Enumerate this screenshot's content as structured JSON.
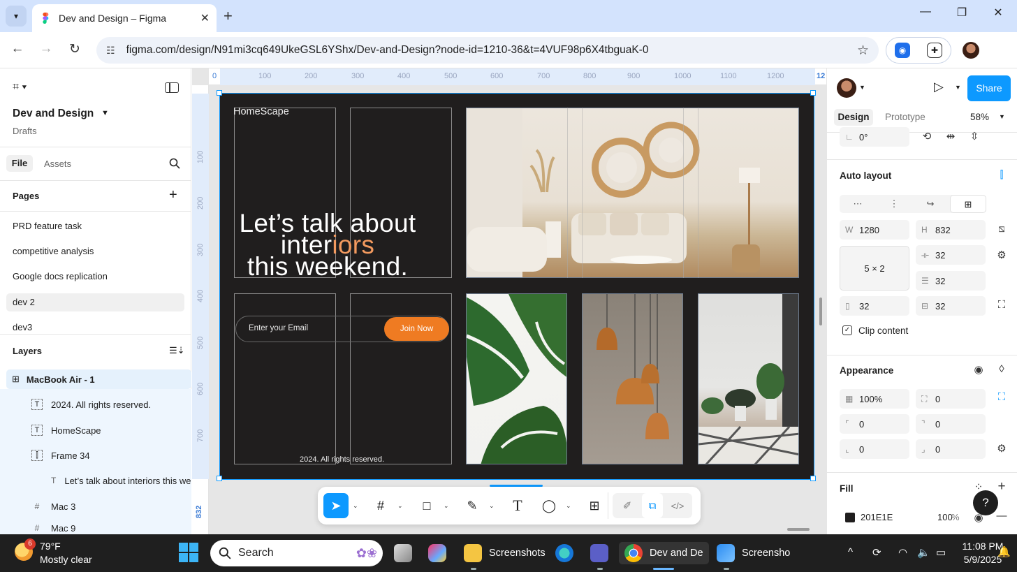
{
  "browser": {
    "tab_title": "Dev and Design – Figma",
    "url": "figma.com/design/N91mi3cq649UkeGSL6YShx/Dev-and-Design?node-id=1210-36&t=4VUF98p6X4tbguaK-0",
    "new_tab": "+",
    "tab_close": "✕"
  },
  "left": {
    "project_name": "Dev and Design",
    "project_location": "Drafts",
    "tab_file": "File",
    "tab_assets": "Assets",
    "pages_title": "Pages",
    "pages": [
      "PRD feature task",
      "competitive analysis",
      "Google docs replication",
      "dev 2",
      "dev3"
    ],
    "active_page": "dev 2",
    "layers_title": "Layers",
    "layers": [
      {
        "label": "MacBook Air - 1",
        "icon": "frame-grid-icon"
      },
      {
        "label": "2024. All rights reserved.",
        "icon": "text-layer-icon"
      },
      {
        "label": "HomeScape",
        "icon": "text-layer-icon"
      },
      {
        "label": "Frame 34",
        "icon": "autolayout-frame-icon"
      },
      {
        "label": "Let’s talk about interiors this weekend.",
        "icon": "text-icon"
      },
      {
        "label": "Mac 3",
        "icon": "hash-frame-icon"
      },
      {
        "label": "Mac 9",
        "icon": "hash-frame-icon"
      }
    ]
  },
  "canvas": {
    "ruler_top": [
      "100",
      "200",
      "300",
      "400",
      "500",
      "600",
      "700",
      "800",
      "900",
      "1000",
      "1100",
      "1200"
    ],
    "ruler_top_start": "0",
    "ruler_top_end": "12",
    "ruler_left": [
      "100",
      "200",
      "300",
      "400",
      "500",
      "600",
      "700"
    ],
    "ruler_left_end": "832",
    "brand": "HomeScape",
    "hero_line1": "Let’s talk about",
    "hero_line2a": "inter",
    "hero_line2b": "iors",
    "hero_line3": "this weekend.",
    "email_placeholder": "Enter your Email",
    "join_button": "Join Now",
    "copyright": "2024. All rights reserved.",
    "accent_color": "#ef7b22",
    "frame_color": "#201E1E"
  },
  "bottom_toolbar": {
    "tools": [
      "move-tool",
      "frame-tool",
      "shape-tool",
      "pen-tool",
      "text-tool",
      "comment-tool",
      "actions-tool"
    ],
    "active": "move-tool"
  },
  "right": {
    "share": "Share",
    "tab_design": "Design",
    "tab_prototype": "Prototype",
    "zoom": "58%",
    "rotation": "0°",
    "auto_layout_title": "Auto layout",
    "width_label": "W",
    "width": "1280",
    "height_label": "H",
    "height": "832",
    "grid": "5 × 2",
    "gap_h": "32",
    "gap_v": "32",
    "padding_h": "32",
    "padding_v": "32",
    "clip_content": "Clip content",
    "appearance_title": "Appearance",
    "opacity": "100%",
    "radius": "0",
    "corner_tl": "0",
    "corner_tr": "0",
    "corner_bl": "0",
    "corner_br": "0",
    "fill_title": "Fill",
    "fill_hex": "201E1E",
    "fill_opacity": "100",
    "fill_percent": "%",
    "help": "?"
  },
  "taskbar": {
    "temperature": "79°F",
    "condition": "Mostly clear",
    "weather_badge": "6",
    "search": "Search",
    "apps": [
      {
        "label": "Screenshots"
      },
      {
        "label": "Dev and De"
      },
      {
        "label": "Screensho"
      }
    ],
    "time": "11:08 PM",
    "date": "5/9/2025"
  }
}
